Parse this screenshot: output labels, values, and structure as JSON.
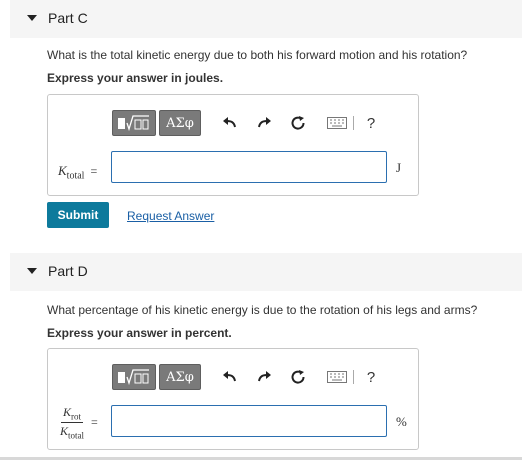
{
  "part_c": {
    "title": "Part C",
    "question": "What is the total kinetic energy due to both his forward motion and his rotation?",
    "instruction": "Express your answer in joules.",
    "variable": "K",
    "variable_sub": "total",
    "equals": "=",
    "unit": "J",
    "input_value": "",
    "submit_label": "Submit",
    "request_label": "Request Answer"
  },
  "part_d": {
    "title": "Part D",
    "question": "What percentage of his kinetic energy is due to the rotation of his legs and arms?",
    "instruction": "Express your answer in percent.",
    "numerator": "K",
    "numerator_sub": "rot",
    "denominator": "K",
    "denominator_sub": "total",
    "equals": "=",
    "unit": "%",
    "input_value": ""
  },
  "toolbar": {
    "greek_label": "ΑΣφ",
    "help_label": "?",
    "icons": [
      "templates-icon",
      "undo-icon",
      "redo-icon",
      "reset-icon",
      "keyboard-icon",
      "help-icon"
    ]
  },
  "colors": {
    "submit_bg": "#0d7a9c",
    "link": "#1a5fa5",
    "input_border": "#2b6fb0",
    "toolbar_btn": "#7a7a7a"
  }
}
